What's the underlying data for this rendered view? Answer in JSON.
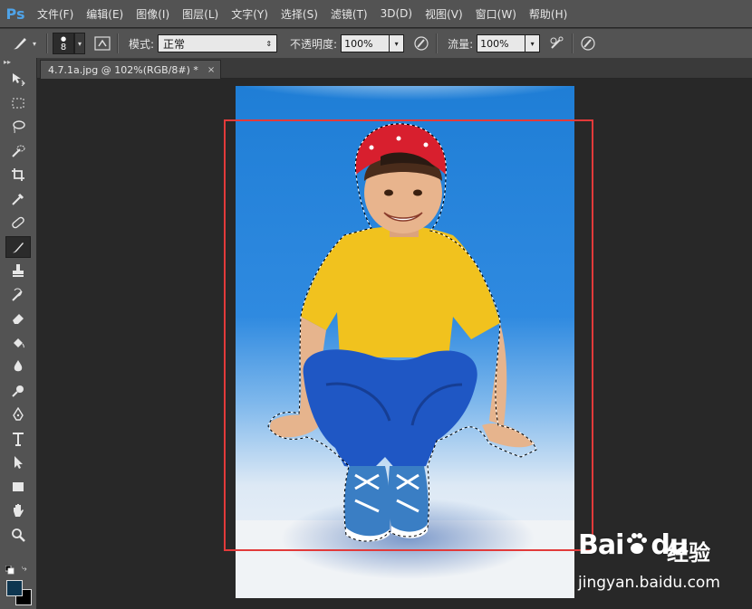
{
  "app": {
    "logo": "Ps"
  },
  "menu": [
    "文件(F)",
    "编辑(E)",
    "图像(I)",
    "图层(L)",
    "文字(Y)",
    "选择(S)",
    "滤镜(T)",
    "3D(D)",
    "视图(V)",
    "窗口(W)",
    "帮助(H)"
  ],
  "options": {
    "brush_size": "8",
    "mode_label": "模式:",
    "mode_value": "正常",
    "opacity_label": "不透明度:",
    "opacity_value": "100%",
    "flow_label": "流量:",
    "flow_value": "100%"
  },
  "document": {
    "tab_title": "4.7.1a.jpg @ 102%(RGB/8#) *",
    "close": "×"
  },
  "tools": [
    "move-tool",
    "marquee-tool",
    "lasso-tool",
    "quick-selection-tool",
    "crop-tool",
    "eyedropper-tool",
    "healing-brush-tool",
    "brush-tool",
    "clone-stamp-tool",
    "history-brush-tool",
    "eraser-tool",
    "paint-bucket-tool",
    "blur-tool",
    "dodge-tool",
    "pen-tool",
    "type-tool",
    "path-selection-tool",
    "rectangle-tool",
    "hand-tool",
    "zoom-tool"
  ],
  "active_tool": "brush-tool",
  "colors": {
    "foreground": "#0e3650",
    "background": "#000000",
    "selection": "#e23a3a"
  },
  "watermark": {
    "logo_left": "Bai",
    "logo_right": "du",
    "brand": "经验",
    "url": "jingyan.baidu.com"
  }
}
